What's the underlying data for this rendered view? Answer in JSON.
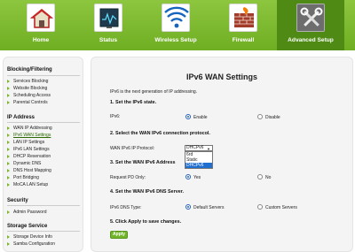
{
  "nav": [
    {
      "label": "Home",
      "icon": "home-icon"
    },
    {
      "label": "Status",
      "icon": "status-monitor-icon"
    },
    {
      "label": "Wireless Setup",
      "icon": "wireless-icon"
    },
    {
      "label": "Firewall",
      "icon": "firewall-icon"
    },
    {
      "label": "Advanced Setup",
      "icon": "tools-icon",
      "active": true
    }
  ],
  "sidebar": {
    "sections": [
      {
        "title": "Blocking/Filtering",
        "items": [
          "Services Blocking",
          "Website Blocking",
          "Scheduling Access",
          "Parental Controls"
        ]
      },
      {
        "title": "IP Address",
        "items": [
          "WAN IP Addressing",
          "IPv6 WAN Settings",
          "LAN IP Settings",
          "IPv6 LAN Settings",
          "DHCP Reservation",
          "Dynamic DNS",
          "DNS Host Mapping",
          "Port Bridging",
          "MoCA LAN Setup"
        ]
      },
      {
        "title": "Security",
        "items": [
          "Admin Password"
        ]
      },
      {
        "title": "Storage Service",
        "items": [
          "Storage Device Info",
          "Samba Configuration"
        ]
      }
    ],
    "current": "IPv6 WAN Settings"
  },
  "main": {
    "title": "IPv6 WAN Settings",
    "intro": "IPv6 is the next generation of IP addressing.",
    "step1": "1. Set the IPv6 state.",
    "ipv6_label": "IPv6:",
    "enable_label": "Enable",
    "disable_label": "Disable",
    "step2": "2. Select the WAN IPv6 connection protocol.",
    "protocol_label": "WAN IPv6 IP Protocol:",
    "protocol_value": "DHCPv6",
    "protocol_options": [
      "6rd",
      "Static",
      "DHCPv6"
    ],
    "step3": "3. Set the WAN IPv6 Address",
    "pd_label": "Request PD Only:",
    "yes_label": "Yes",
    "no_label": "No",
    "step4": "4. Set the WAN IPv6 DNS Server.",
    "dns_label": "IPv6 DNS Type:",
    "default_servers_label": "Default Servers",
    "custom_servers_label": "Custom Servers",
    "step5": "5. Click Apply to save changes.",
    "apply_label": "Apply"
  },
  "colors": {
    "nav_green": "#7ab832",
    "active_tab": "#4f8a14",
    "accent": "#1f6fd1"
  }
}
